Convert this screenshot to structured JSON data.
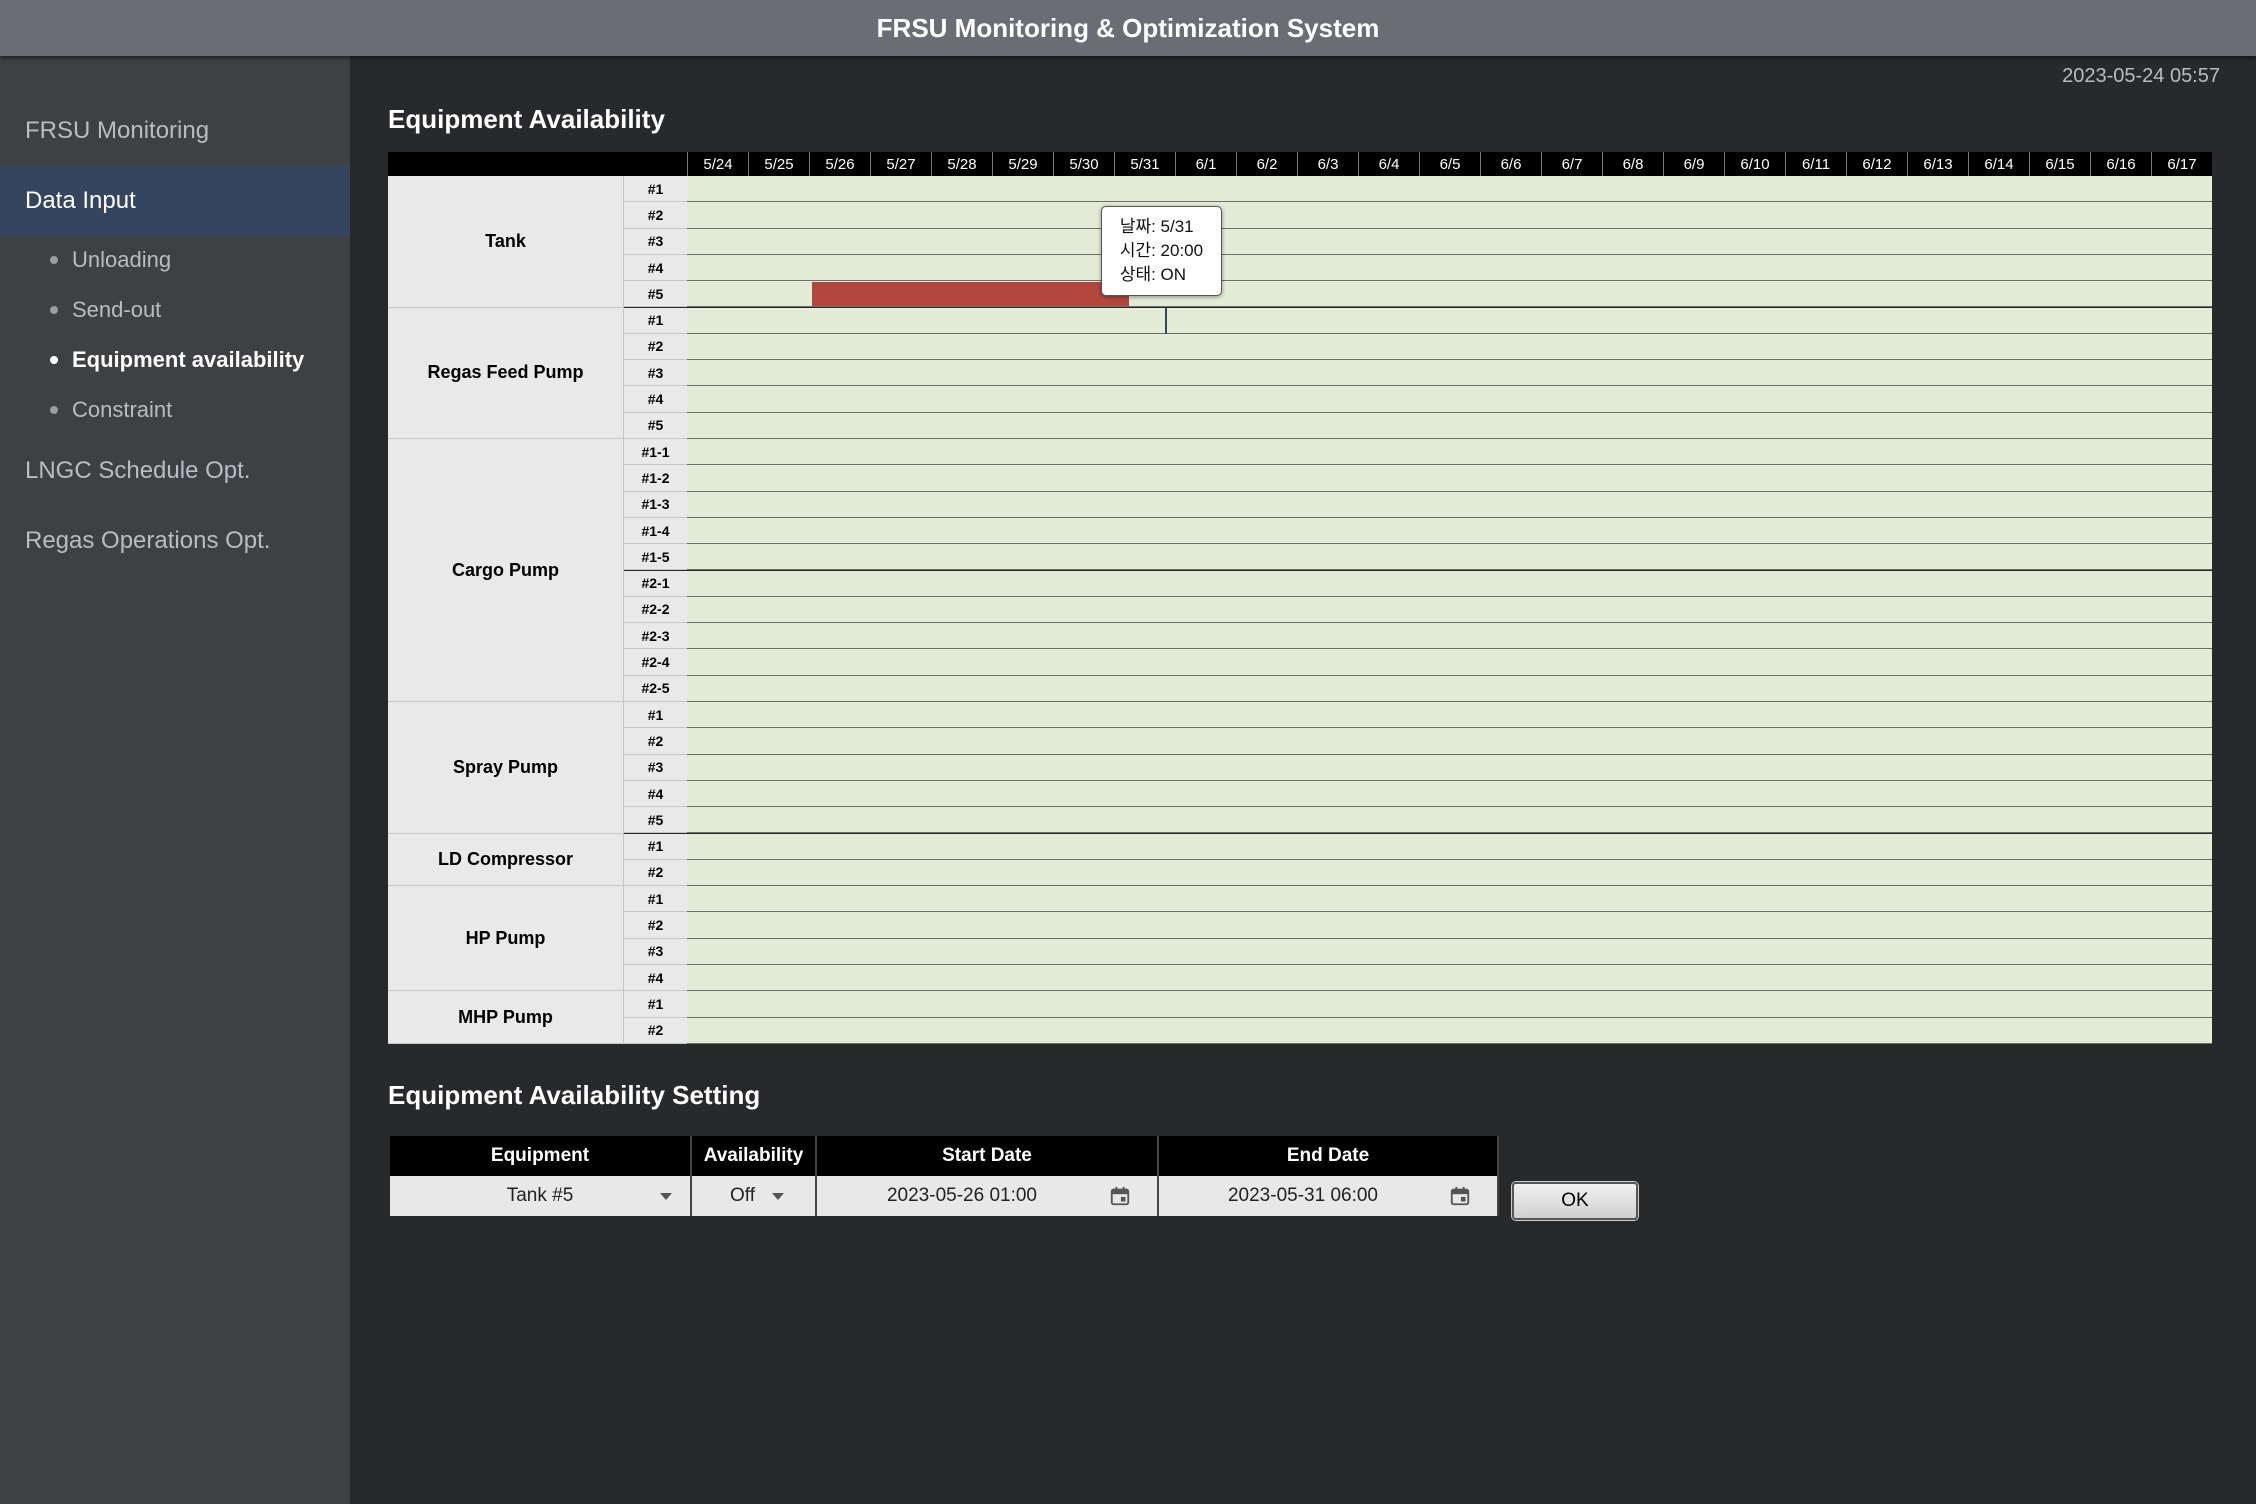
{
  "app": {
    "title": "FRSU Monitoring & Optimization System",
    "timestamp": "2023-05-24 05:57"
  },
  "sidebar": {
    "items": [
      {
        "label": "FRSU Monitoring"
      },
      {
        "label": "Data Input",
        "active": true
      },
      {
        "label": "LNGC Schedule Opt."
      },
      {
        "label": "Regas Operations Opt."
      }
    ],
    "subitems": [
      {
        "label": "Unloading"
      },
      {
        "label": "Send-out"
      },
      {
        "label": "Equipment availability",
        "active": true
      },
      {
        "label": "Constraint"
      }
    ]
  },
  "availability": {
    "title": "Equipment Availability",
    "dates": [
      "5/24",
      "5/25",
      "5/26",
      "5/27",
      "5/28",
      "5/29",
      "5/30",
      "5/31",
      "6/1",
      "6/2",
      "6/3",
      "6/4",
      "6/5",
      "6/6",
      "6/7",
      "6/8",
      "6/9",
      "6/10",
      "6/11",
      "6/12",
      "6/13",
      "6/14",
      "6/15",
      "6/16",
      "6/17"
    ],
    "groups": [
      {
        "name": "Tank",
        "units": [
          "#1",
          "#2",
          "#3",
          "#4",
          "#5"
        ]
      },
      {
        "name": "Regas Feed Pump",
        "units": [
          "#1",
          "#2",
          "#3",
          "#4",
          "#5"
        ]
      },
      {
        "name": "Cargo Pump",
        "units": [
          "#1-1",
          "#1-2",
          "#1-3",
          "#1-4",
          "#1-5",
          "#2-1",
          "#2-2",
          "#2-3",
          "#2-4",
          "#2-5"
        ]
      },
      {
        "name": "Spray Pump",
        "units": [
          "#1",
          "#2",
          "#3",
          "#4",
          "#5"
        ]
      },
      {
        "name": "LD Compressor",
        "units": [
          "#1",
          "#2"
        ]
      },
      {
        "name": "HP Pump",
        "units": [
          "#1",
          "#2",
          "#3",
          "#4"
        ]
      },
      {
        "name": "MHP Pump",
        "units": [
          "#1",
          "#2"
        ]
      }
    ],
    "off_periods": [
      {
        "equipment": "Tank #5",
        "start": "2023-05-26 01:00",
        "end": "2023-05-31 06:00"
      }
    ],
    "tooltip": {
      "date_line": "날짜: 5/31",
      "time_line": "시간: 20:00",
      "status_line": "상태: ON"
    },
    "colors": {
      "on": "#e2ecd6",
      "off": "#b3473e"
    }
  },
  "setting": {
    "title": "Equipment Availability Setting",
    "headers": {
      "equipment": "Equipment",
      "availability": "Availability",
      "start": "Start Date",
      "end": "End Date"
    },
    "values": {
      "equipment": "Tank #5",
      "availability": "Off",
      "start": "2023-05-26 01:00",
      "end": "2023-05-31 06:00"
    },
    "ok_label": "OK"
  }
}
